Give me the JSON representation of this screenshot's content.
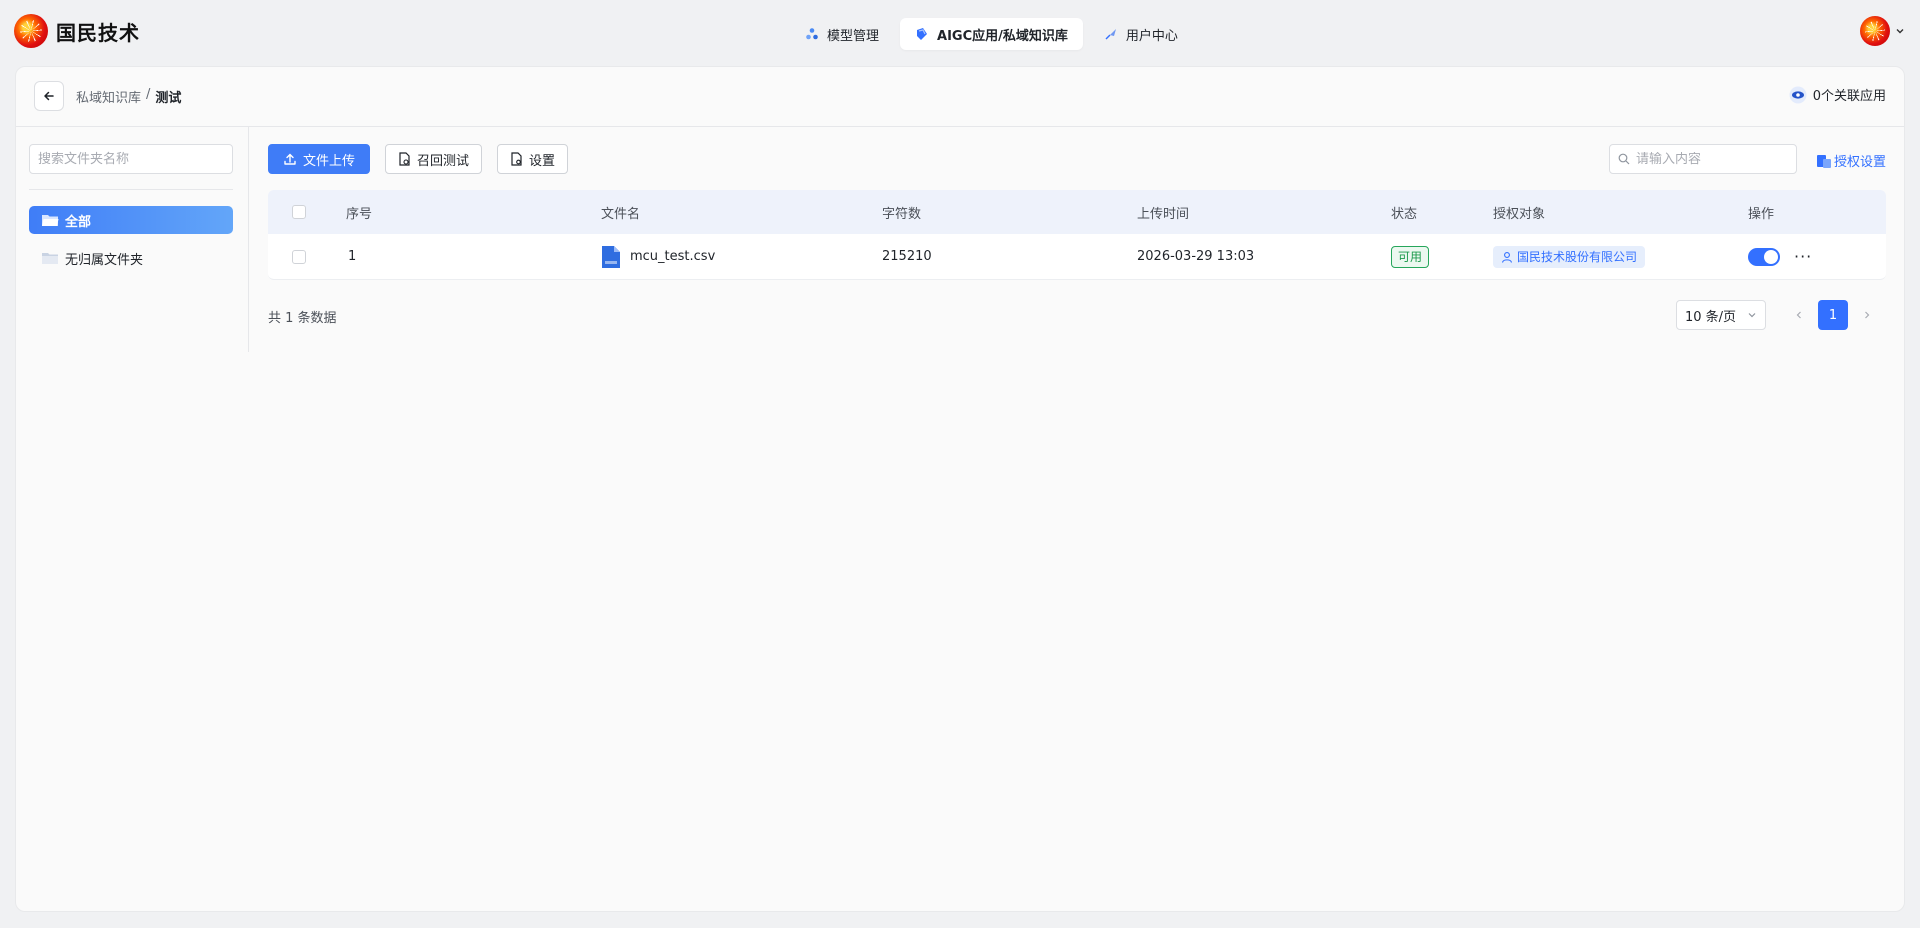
{
  "brand": {
    "name": "国民技术"
  },
  "nav": {
    "tabs": [
      {
        "label": "模型管理",
        "icon": "model-icon",
        "active": false
      },
      {
        "label": "AIGC应用/私域知识库",
        "icon": "knowledge-icon",
        "active": true
      },
      {
        "label": "用户中心",
        "icon": "user-center-icon",
        "active": false
      }
    ]
  },
  "breadcrumb": {
    "parent": "私域知识库",
    "separator": "/",
    "current": "测试"
  },
  "related_apps": {
    "label": "0个关联应用"
  },
  "sidebar": {
    "search_placeholder": "搜索文件夹名称",
    "folders": [
      {
        "label": "全部",
        "active": true
      },
      {
        "label": "无归属文件夹",
        "active": false
      }
    ]
  },
  "toolbar": {
    "upload_label": "文件上传",
    "recall_test_label": "召回测试",
    "settings_label": "设置",
    "search_placeholder": "请输入内容",
    "auth_settings_label": "授权设置"
  },
  "table": {
    "columns": [
      "序号",
      "文件名",
      "字符数",
      "上传时间",
      "状态",
      "授权对象",
      "操作"
    ],
    "rows": [
      {
        "index": "1",
        "file_name": "mcu_test.csv",
        "file_icon": "doc-file-icon",
        "char_count": "215210",
        "upload_time": "2026-03-29 13:03",
        "status": "可用",
        "auth_target": "国民技术股份有限公司",
        "enabled": true
      }
    ]
  },
  "pagination": {
    "total_text": "共 1 条数据",
    "page_size": "10 条/页",
    "current_page": "1"
  },
  "colors": {
    "accent": "#3370ff",
    "primary_button": "#3f7cf7",
    "status_green": "#1c9a4c"
  }
}
